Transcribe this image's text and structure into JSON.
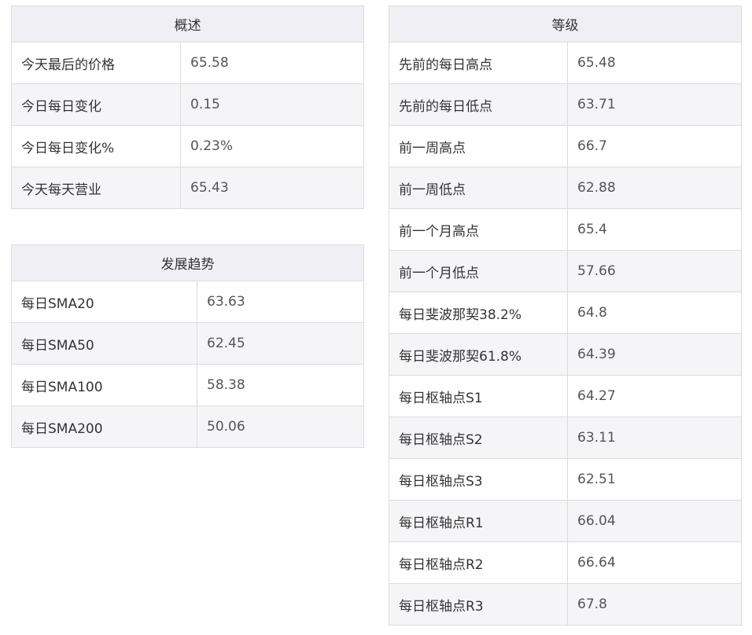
{
  "overview": {
    "title": "概述",
    "rows": [
      {
        "label": "今天最后的价格",
        "value": "65.58"
      },
      {
        "label": "今日每日变化",
        "value": "0.15"
      },
      {
        "label": "今日每日变化%",
        "value": "0.23%"
      },
      {
        "label": "今天每天营业",
        "value": "65.43"
      }
    ]
  },
  "trend": {
    "title": "发展趋势",
    "rows": [
      {
        "label": "每日SMA20",
        "value": "63.63"
      },
      {
        "label": "每日SMA50",
        "value": "62.45"
      },
      {
        "label": "每日SMA100",
        "value": "58.38"
      },
      {
        "label": "每日SMA200",
        "value": "50.06"
      }
    ]
  },
  "levels": {
    "title": "等级",
    "rows": [
      {
        "label": "先前的每日高点",
        "value": "65.48"
      },
      {
        "label": "先前的每日低点",
        "value": "63.71"
      },
      {
        "label": "前一周高点",
        "value": "66.7"
      },
      {
        "label": "前一周低点",
        "value": "62.88"
      },
      {
        "label": "前一个月高点",
        "value": "65.4"
      },
      {
        "label": "前一个月低点",
        "value": "57.66"
      },
      {
        "label": "每日斐波那契38.2%",
        "value": "64.8"
      },
      {
        "label": "每日斐波那契61.8%",
        "value": "64.39"
      },
      {
        "label": "每日枢轴点S1",
        "value": "64.27"
      },
      {
        "label": "每日枢轴点S2",
        "value": "63.11"
      },
      {
        "label": "每日枢轴点S3",
        "value": "62.51"
      },
      {
        "label": "每日枢轴点R1",
        "value": "66.04"
      },
      {
        "label": "每日枢轴点R2",
        "value": "66.64"
      },
      {
        "label": "每日枢轴点R3",
        "value": "67.8"
      }
    ]
  }
}
